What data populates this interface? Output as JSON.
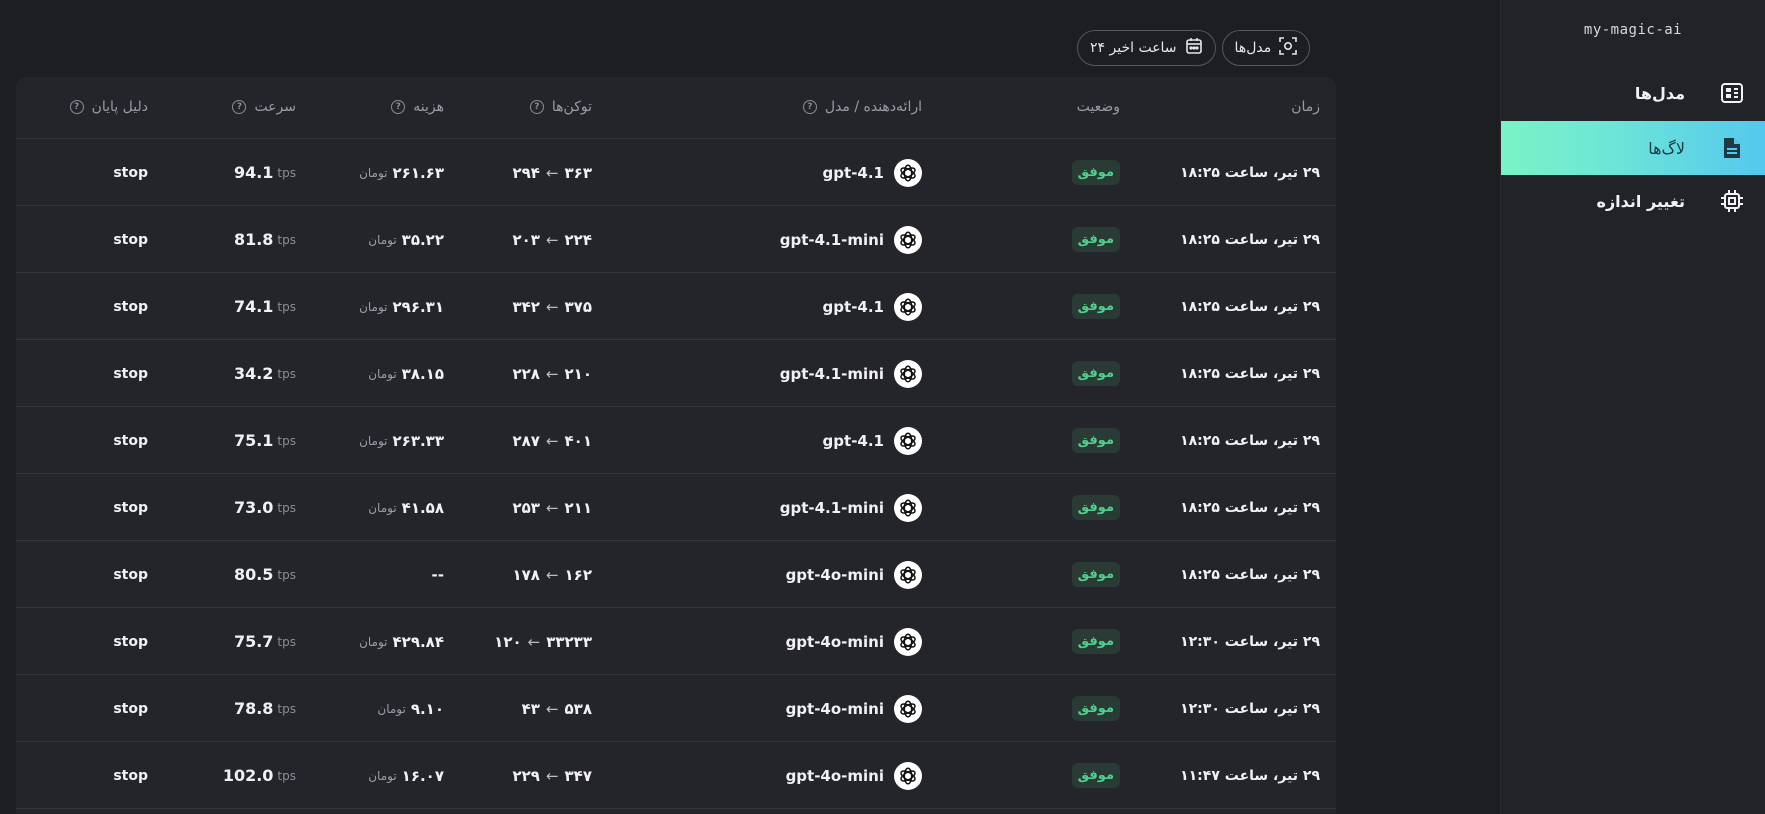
{
  "sidebar": {
    "brand": "my-magic-ai",
    "items": [
      {
        "label": "مدل‌ها",
        "icon": "models-icon",
        "active": false
      },
      {
        "label": "لاگ‌ها",
        "icon": "document-icon",
        "active": true
      },
      {
        "label": "تغییر اندازه",
        "icon": "chip-icon",
        "active": false
      }
    ]
  },
  "filters": {
    "models_label": "مدل‌ها",
    "range_label": "۲۴ ساعت اخیر"
  },
  "table": {
    "headers": {
      "time": "زمان",
      "status": "وضعیت",
      "provider_model": "ارائه‌دهنده / مدل",
      "tokens": "توکن‌ها",
      "cost": "هزینه",
      "speed": "سرعت",
      "finish_reason": "دلیل پایان"
    },
    "cost_unit": "تومان",
    "speed_unit": "tps",
    "token_arrow": "←",
    "rows": [
      {
        "time": "۲۹ تیر، ساعت ۱۸:۲۵",
        "status": "موفق",
        "model": "gpt-4.1",
        "tok_in": "۳۶۳",
        "tok_out": "۲۹۴",
        "cost": "۲۶۱.۶۳",
        "speed": "94.1",
        "finish": "stop"
      },
      {
        "time": "۲۹ تیر، ساعت ۱۸:۲۵",
        "status": "موفق",
        "model": "gpt-4.1-mini",
        "tok_in": "۲۲۴",
        "tok_out": "۲۰۳",
        "cost": "۳۵.۲۲",
        "speed": "81.8",
        "finish": "stop"
      },
      {
        "time": "۲۹ تیر، ساعت ۱۸:۲۵",
        "status": "موفق",
        "model": "gpt-4.1",
        "tok_in": "۳۷۵",
        "tok_out": "۳۴۲",
        "cost": "۲۹۶.۳۱",
        "speed": "74.1",
        "finish": "stop"
      },
      {
        "time": "۲۹ تیر، ساعت ۱۸:۲۵",
        "status": "موفق",
        "model": "gpt-4.1-mini",
        "tok_in": "۲۱۰",
        "tok_out": "۲۲۸",
        "cost": "۳۸.۱۵",
        "speed": "34.2",
        "finish": "stop"
      },
      {
        "time": "۲۹ تیر، ساعت ۱۸:۲۵",
        "status": "موفق",
        "model": "gpt-4.1",
        "tok_in": "۴۰۱",
        "tok_out": "۲۸۷",
        "cost": "۲۶۳.۳۳",
        "speed": "75.1",
        "finish": "stop"
      },
      {
        "time": "۲۹ تیر، ساعت ۱۸:۲۵",
        "status": "موفق",
        "model": "gpt-4.1-mini",
        "tok_in": "۲۱۱",
        "tok_out": "۲۵۳",
        "cost": "۴۱.۵۸",
        "speed": "73.0",
        "finish": "stop"
      },
      {
        "time": "۲۹ تیر، ساعت ۱۸:۲۵",
        "status": "موفق",
        "model": "gpt-4o-mini",
        "tok_in": "۱۶۲",
        "tok_out": "۱۷۸",
        "cost": "--",
        "speed": "80.5",
        "finish": "stop"
      },
      {
        "time": "۲۹ تیر، ساعت ۱۲:۳۰",
        "status": "موفق",
        "model": "gpt-4o-mini",
        "tok_in": "۳۳۲۳۳",
        "tok_out": "۱۲۰",
        "cost": "۴۲۹.۸۴",
        "speed": "75.7",
        "finish": "stop"
      },
      {
        "time": "۲۹ تیر، ساعت ۱۲:۳۰",
        "status": "موفق",
        "model": "gpt-4o-mini",
        "tok_in": "۵۳۸",
        "tok_out": "۴۳",
        "cost": "۹.۱۰",
        "speed": "78.8",
        "finish": "stop"
      },
      {
        "time": "۲۹ تیر، ساعت ۱۱:۴۷",
        "status": "موفق",
        "model": "gpt-4o-mini",
        "tok_in": "۳۴۷",
        "tok_out": "۲۲۹",
        "cost": "۱۶.۰۷",
        "speed": "102.0",
        "finish": "stop"
      }
    ]
  }
}
